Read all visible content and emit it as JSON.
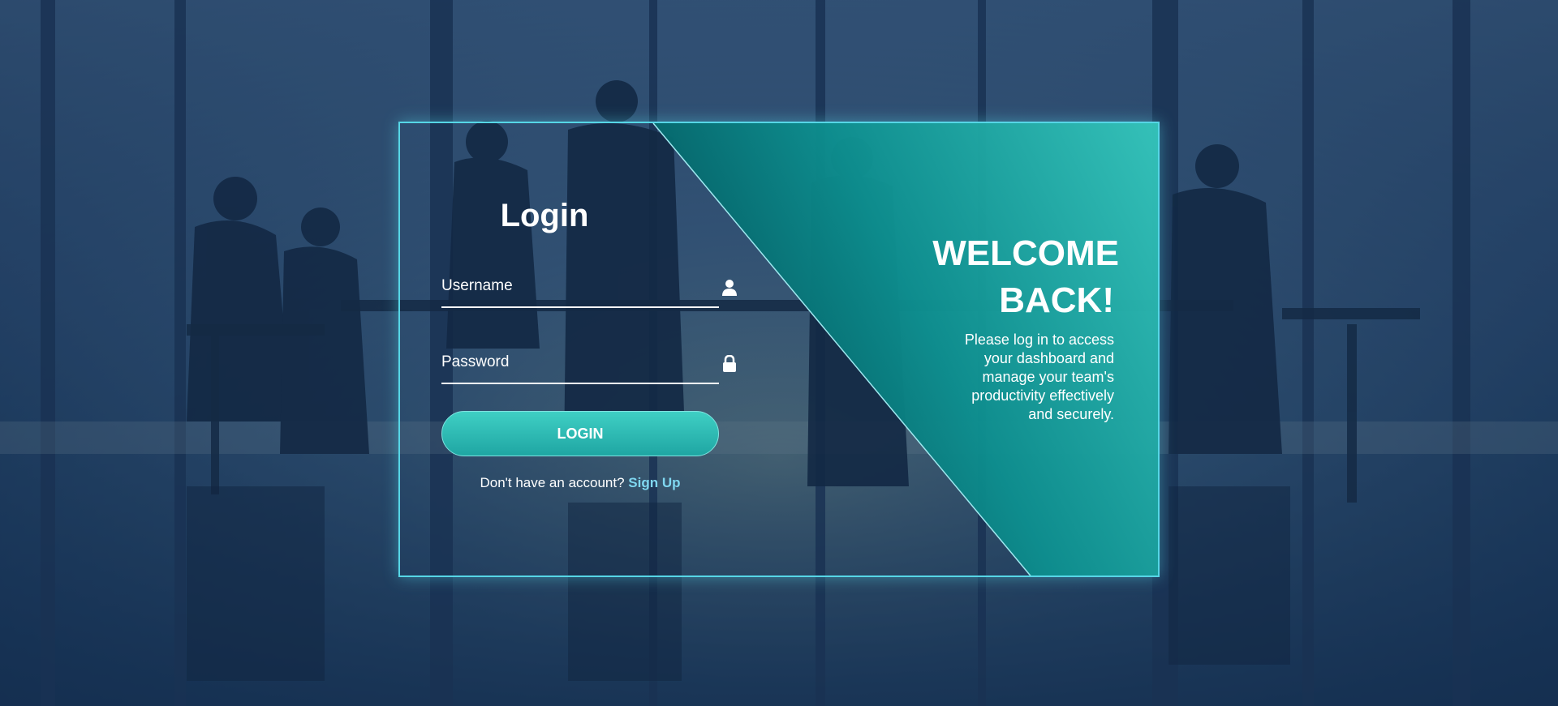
{
  "login_panel": {
    "title": "Login",
    "username": {
      "placeholder": "Username",
      "icon": "user-icon"
    },
    "password": {
      "placeholder": "Password",
      "icon": "lock-icon"
    },
    "submit_label": "LOGIN",
    "signup_prompt": "Don't have an account?",
    "signup_link": "Sign Up"
  },
  "welcome_panel": {
    "heading_line1": "WELCOME",
    "heading_line2": "BACK!",
    "message": "Please log in to access your dashboard and manage your team's productivity effectively and securely."
  },
  "colors": {
    "accent": "#2fbfb6",
    "border": "#56d6e6",
    "link": "#7fd7f0",
    "panel_dark": "#00565a",
    "panel_light": "#33c4ba"
  }
}
